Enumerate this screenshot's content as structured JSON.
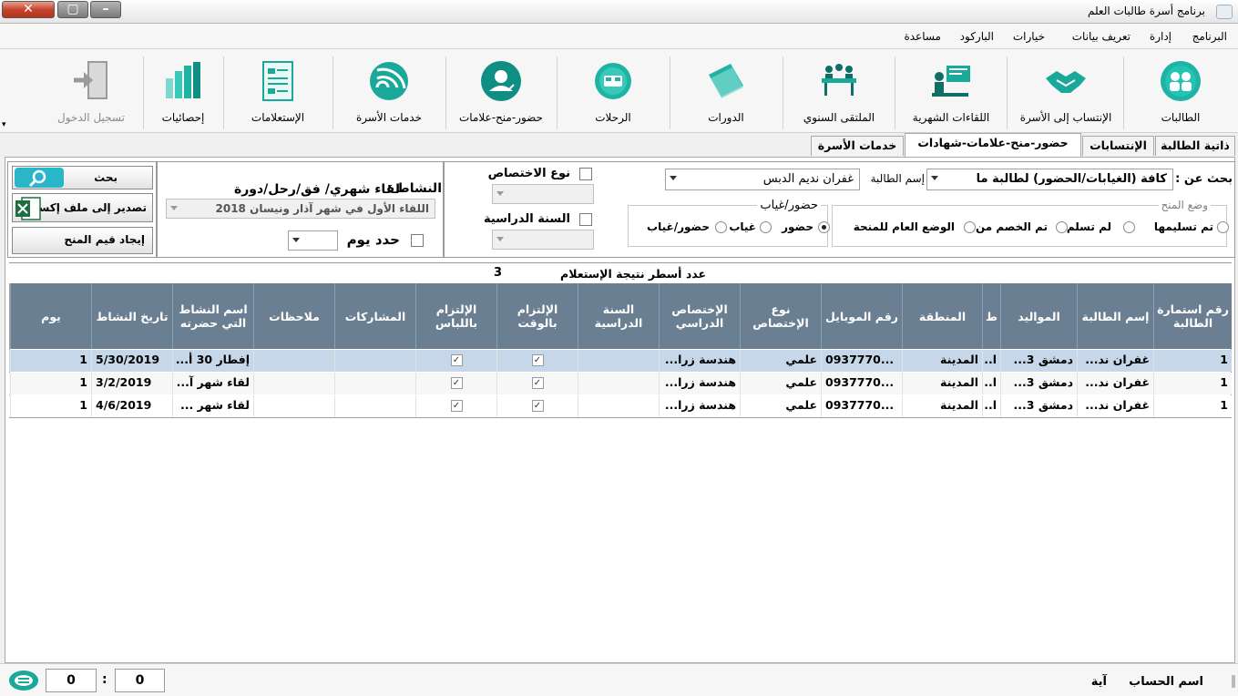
{
  "window": {
    "title": "برنامج أسرة طالبات العلم"
  },
  "menu": {
    "program": "البرنامج",
    "admin": "إدارة",
    "define": "تعريف بيانات",
    "options": "خيارات",
    "barcode": "الباركود",
    "help": "مساعدة"
  },
  "toolbar": {
    "students": "الطالبات",
    "join": "الإنتساب إلى الأسرة",
    "monthly": "اللقاءات الشهرية",
    "forum": "الملتقى السنوي",
    "courses": "الدورات",
    "trips": "الرحلات",
    "attendance": "حضور-منح-علامات",
    "services": "خدمات الأسرة",
    "queries": "الإستعلامات",
    "stats": "إحصائيات",
    "login": "تسجيل الدخول"
  },
  "tabs": {
    "profile": "ذاتية الطالبة",
    "memberships": "الإنتسابات",
    "attendance": "حضور-منح-علامات-شهادات",
    "services": "خدمات الأسرة"
  },
  "search": {
    "search_for_label": "بحث عن :",
    "search_for_value": "كافة (الغيابات/الحضور) لطالبة ما",
    "student_name_label": "إسم الطالبة",
    "student_name_value": "غفران نديم الدبس",
    "grant_status_label": "وضع المنح",
    "grant_delivered": "تم تسليمها",
    "grant_not_delivered": "لم تسلم",
    "grant_deducted": "تم الخصم من",
    "grant_general": "الوضع العام للمنحة",
    "attendance_label": "حضور/غياب",
    "att_present": "حضور",
    "att_absent": "غياب",
    "att_both": "حضور/غياب",
    "spec_type_label": "نوع الاختصاص",
    "study_year_label": "السنة الدراسية",
    "activity_label": "النشاط :",
    "activity_type": "لقاء شهري/ فق/رحل/دورة",
    "activity_value": "اللقاء الأول في شهر آذار ونيسان 2018",
    "limit_day_label": "حدد يوم",
    "search_button": "بحث",
    "export_button": "تصدير إلى ملف إكسل",
    "grants_button": "إيجاد قيم المنح"
  },
  "results": {
    "count_label": "عدد أسطر نتيجة الإستعلام",
    "count": "3"
  },
  "grid": {
    "headers": [
      "رقم استمارة الطالبة",
      "إسم الطالبة",
      "المواليد",
      "ط",
      "المنطقة",
      "رقم الموبايل",
      "نوع الإختصاص",
      "الإختصاص الدراسي",
      "السنة الدراسية",
      "الإلتزام بالوقت",
      "الإلتزام باللباس",
      "المشاركات",
      "ملاحظات",
      "اسم النشاط التي حضرته",
      "تاريخ النشاط",
      "يوم"
    ],
    "rows": [
      {
        "num": "1",
        "name": "غفران ند...",
        "birth": "دمشق 3...",
        "t": "ا...",
        "region": "المدينة",
        "mobile": "0937770...",
        "spec_type": "علمي",
        "spec": "هندسة زرا...",
        "year": "",
        "time": "✓",
        "dress": "✓",
        "part": "",
        "notes": "",
        "activity": "إفطار 30 أ...",
        "date": "5/30/2019",
        "day": "1"
      },
      {
        "num": "1",
        "name": "غفران ند...",
        "birth": "دمشق 3...",
        "t": "ا...",
        "region": "المدينة",
        "mobile": "0937770...",
        "spec_type": "علمي",
        "spec": "هندسة زرا...",
        "year": "",
        "time": "✓",
        "dress": "✓",
        "part": "",
        "notes": "",
        "activity": "لقاء شهر آ...",
        "date": "3/2/2019",
        "day": "1"
      },
      {
        "num": "1",
        "name": "غفران ند...",
        "birth": "دمشق 3...",
        "t": "ا...",
        "region": "المدينة",
        "mobile": "0937770...",
        "spec_type": "علمي",
        "spec": "هندسة زرا...",
        "year": "",
        "time": "✓",
        "dress": "✓",
        "part": "",
        "notes": "",
        "activity": "لقاء شهر ...",
        "date": "4/6/2019",
        "day": "1"
      }
    ]
  },
  "status": {
    "account_label": "اسم الحساب",
    "account_value": "آية",
    "counter_a": "0",
    "sep": ":",
    "counter_b": "0"
  },
  "colors": {
    "header": "#6b7f92",
    "selected_row": "#c6d7ea",
    "accent": "#1aa89a",
    "close": "#c5452c"
  }
}
